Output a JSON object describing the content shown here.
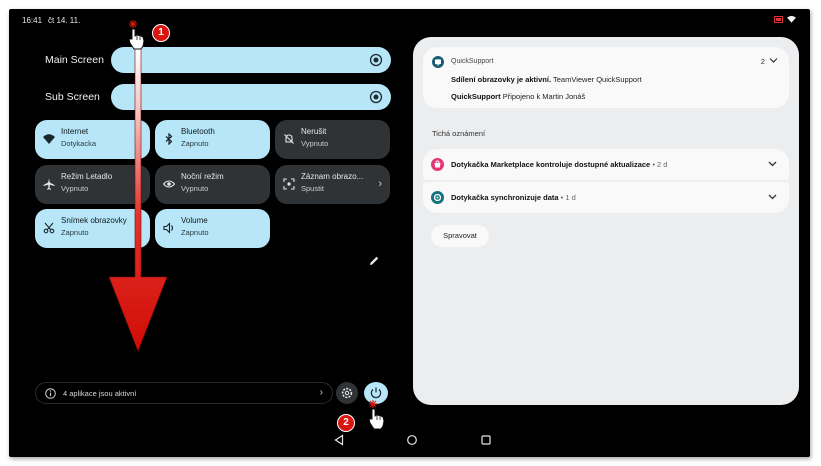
{
  "status_bar": {
    "time": "16:41",
    "date": "čt 14. 11."
  },
  "brightness": {
    "main_label": "Main Screen",
    "sub_label": "Sub Screen"
  },
  "tiles": [
    {
      "title": "Internet",
      "subtitle": "Dotykacka",
      "state": "on",
      "icon": "wifi-icon"
    },
    {
      "title": "Bluetooth",
      "subtitle": "Zapnuto",
      "state": "on",
      "icon": "bluetooth-icon"
    },
    {
      "title": "Nerušit",
      "subtitle": "Vypnuto",
      "state": "off",
      "icon": "do-not-disturb-icon"
    },
    {
      "title": "Režim Letadlo",
      "subtitle": "Vypnuto",
      "state": "off",
      "icon": "airplane-icon"
    },
    {
      "title": "Noční režim",
      "subtitle": "Vypnuto",
      "state": "off",
      "icon": "eye-icon"
    },
    {
      "title": "Záznam obrazo...",
      "subtitle": "Spustit",
      "state": "off",
      "icon": "screen-record-icon"
    },
    {
      "title": "Snímek obrazovky",
      "subtitle": "Zapnuto",
      "state": "on",
      "icon": "scissors-icon"
    },
    {
      "title": "Volume",
      "subtitle": "Zapnuto",
      "state": "on",
      "icon": "volume-icon"
    }
  ],
  "footer": {
    "active_apps": "4 aplikace jsou aktivní",
    "chevron": "›"
  },
  "notifications": {
    "quicksupport": {
      "app_name": "QuickSupport",
      "count": "2",
      "line1_bold": "Sdílení obrazovky je aktivní.",
      "line1_rest": "TeamViewer QuickSupport",
      "line2_bold": "QuickSupport",
      "line2_rest": "Připojeno k Martin Jonáš"
    },
    "silent_header": "Tichá oznámení",
    "items": [
      {
        "title": "Dotykačka Marketplace kontroluje dostupné aktualizace",
        "time": " • 2 d"
      },
      {
        "title": "Dotykačka synchronizuje data",
        "time": " • 1 d"
      }
    ],
    "manage_button": "Spravovat"
  },
  "annotations": {
    "step1": "1",
    "step2": "2"
  },
  "colors": {
    "tile_on": "#b6e6f7",
    "tile_off": "#2f3336",
    "annotation_red": "#d8160f",
    "panel": "#ecedef"
  }
}
